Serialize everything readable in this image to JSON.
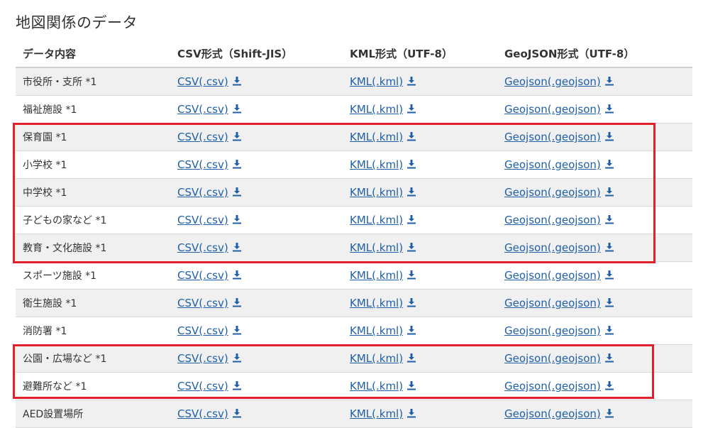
{
  "section": {
    "title": "地図関係のデータ"
  },
  "table": {
    "headers": [
      "データ内容",
      "CSV形式（Shift-JIS）",
      "KML形式（UTF-8）",
      "GeoJSON形式（UTF-8）"
    ],
    "link_labels": {
      "csv": "CSV(.csv)",
      "kml": "KML(.kml)",
      "geojson": "Geojson(.geojson)"
    },
    "link_color": "#1f5fa8",
    "rows": [
      {
        "name": "市役所・支所 *1"
      },
      {
        "name": "福祉施設 *1"
      },
      {
        "name": "保育園 *1"
      },
      {
        "name": "小学校 *1"
      },
      {
        "name": "中学校 *1"
      },
      {
        "name": "子どもの家など *1"
      },
      {
        "name": "教育・文化施設 *1"
      },
      {
        "name": "スポーツ施設 *1"
      },
      {
        "name": "衛生施設 *1"
      },
      {
        "name": "消防署 *1"
      },
      {
        "name": "公園・広場など *1"
      },
      {
        "name": "避難所など *1"
      },
      {
        "name": "AED設置場所"
      }
    ]
  },
  "highlights": {
    "color": "#e0202a",
    "groups": [
      [
        "保育園 *1",
        "小学校 *1",
        "中学校 *1",
        "子どもの家など *1",
        "教育・文化施設 *1"
      ],
      [
        "公園・広場など *1",
        "避難所など *1"
      ]
    ]
  },
  "icons": {
    "download": "download-icon"
  }
}
